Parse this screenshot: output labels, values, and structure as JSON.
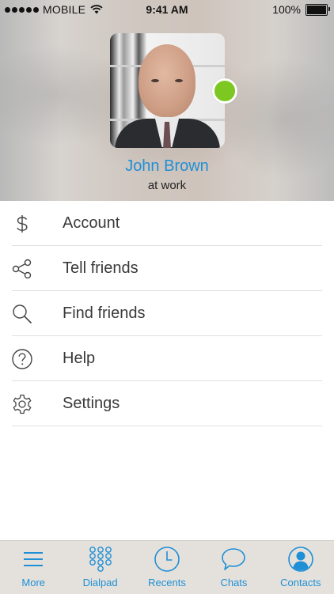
{
  "status_bar": {
    "carrier": "MOBILE",
    "time": "9:41 AM",
    "battery": "100%"
  },
  "profile": {
    "name": "John Brown",
    "status": "at work",
    "presence": "online",
    "presence_color": "#7dc722"
  },
  "menu": {
    "items": [
      {
        "label": "Account",
        "icon": "dollar-icon"
      },
      {
        "label": "Tell friends",
        "icon": "share-icon"
      },
      {
        "label": "Find friends",
        "icon": "search-icon"
      },
      {
        "label": "Help",
        "icon": "help-icon"
      },
      {
        "label": "Settings",
        "icon": "gear-icon"
      }
    ]
  },
  "tabbar": {
    "accent_color": "#1f8fd6",
    "tabs": [
      {
        "label": "More",
        "icon": "menu-icon",
        "active": true
      },
      {
        "label": "Dialpad",
        "icon": "dialpad-icon"
      },
      {
        "label": "Recents",
        "icon": "clock-icon"
      },
      {
        "label": "Chats",
        "icon": "chat-bubble-icon"
      },
      {
        "label": "Contacts",
        "icon": "contact-icon"
      }
    ]
  }
}
